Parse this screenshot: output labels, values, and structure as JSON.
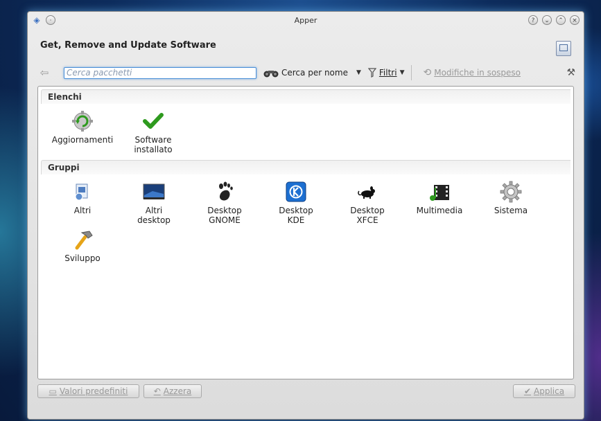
{
  "window": {
    "title": "Apper"
  },
  "header": {
    "title": "Get, Remove and Update Software"
  },
  "toolbar": {
    "search_placeholder": "Cerca pacchetti",
    "search_mode_label": "Cerca per nome",
    "filters_label": "Filtri",
    "pending_label": "Modifiche in sospeso"
  },
  "lists": {
    "title": "Elenchi",
    "items": [
      {
        "label": "Aggiornamenti",
        "icon": "updates-icon"
      },
      {
        "label": "Software\ninstallato",
        "icon": "checkmark-icon"
      }
    ]
  },
  "groups": {
    "title": "Gruppi",
    "items": [
      {
        "label": "Altri",
        "icon": "other-icon"
      },
      {
        "label": "Altri\ndesktop",
        "icon": "desktop-icon"
      },
      {
        "label": "Desktop\nGNOME",
        "icon": "gnome-icon"
      },
      {
        "label": "Desktop\nKDE",
        "icon": "kde-icon"
      },
      {
        "label": "Desktop\nXFCE",
        "icon": "xfce-icon"
      },
      {
        "label": "Multimedia",
        "icon": "multimedia-icon"
      },
      {
        "label": "Sistema",
        "icon": "system-gear-icon"
      },
      {
        "label": "Sviluppo",
        "icon": "hammer-icon"
      }
    ]
  },
  "footer": {
    "defaults_label": "Valori predefiniti",
    "reset_label": "Azzera",
    "apply_label": "Applica"
  },
  "colors": {
    "accent": "#4a8fd8",
    "check": "#2e9a1e",
    "kde": "#1c6fd1"
  }
}
